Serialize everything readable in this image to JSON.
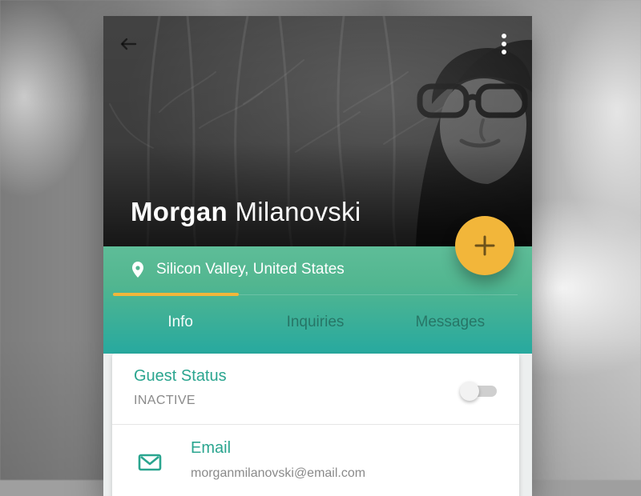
{
  "profile": {
    "first_name": "Morgan",
    "last_name": "Milanovski",
    "location": "Silicon Valley, United States"
  },
  "tabs": [
    {
      "label": "Info",
      "active": true
    },
    {
      "label": "Inquiries",
      "active": false
    },
    {
      "label": "Messages",
      "active": false
    }
  ],
  "fab": {
    "icon": "plus-icon"
  },
  "card": {
    "guest_status": {
      "title": "Guest Status",
      "value": "INACTIVE",
      "toggle_on": false
    },
    "email": {
      "title": "Email",
      "value": "morganmilanovski@email.com",
      "icon": "mail-icon"
    }
  },
  "icons": {
    "back": "arrow-left-icon",
    "more": "more-vert-icon",
    "location": "location-pin-icon"
  },
  "colors": {
    "accent_teal": "#2aa58f",
    "band_green_top": "#5ebd98",
    "band_teal_bottom": "#27a99f",
    "fab_yellow": "#f2b63a",
    "hero_dark": "#1c1c1c",
    "text_muted": "#8a8a8a"
  }
}
